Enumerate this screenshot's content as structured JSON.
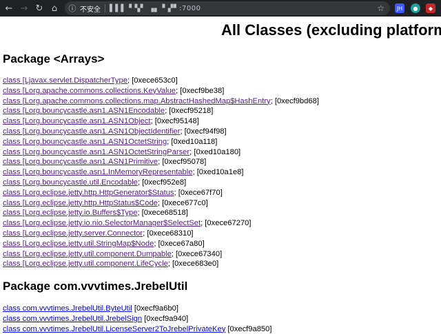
{
  "browser": {
    "security_label": "不安全",
    "url": "▌▌▌ ▘▚▘ ▗▖ ▘▞▘:7000"
  },
  "page": {
    "title": "All Classes (excluding platform"
  },
  "packages": [
    {
      "heading": "Package <Arrays>",
      "classes": [
        {
          "link": "class [Ljavax.servlet.DispatcherType",
          "addr": "; [0xece653c0]"
        },
        {
          "link": "class [Lorg.apache.commons.collections.KeyValue",
          "addr": "; [0xecf9be38]"
        },
        {
          "link": "class [Lorg.apache.commons.collections.map.AbstractHashedMap$HashEntry",
          "addr": "; [0xecf9bd68]"
        },
        {
          "link": "class [Lorg.bouncycastle.asn1.ASN1Encodable",
          "addr": "; [0xecf95218]"
        },
        {
          "link": "class [Lorg.bouncycastle.asn1.ASN1Object",
          "addr": "; [0xecf95148]"
        },
        {
          "link": "class [Lorg.bouncycastle.asn1.ASN1ObjectIdentifier",
          "addr": "; [0xecf94f98]"
        },
        {
          "link": "class [Lorg.bouncycastle.asn1.ASN1OctetString",
          "addr": "; [0xed10a118]"
        },
        {
          "link": "class [Lorg.bouncycastle.asn1.ASN1OctetStringParser",
          "addr": "; [0xed10a180]"
        },
        {
          "link": "class [Lorg.bouncycastle.asn1.ASN1Primitive",
          "addr": "; [0xecf95078]"
        },
        {
          "link": "class [Lorg.bouncycastle.asn1.InMemoryRepresentable",
          "addr": "; [0xed10a1e8]"
        },
        {
          "link": "class [Lorg.bouncycastle.util.Encodable",
          "addr": "; [0xecf952e8]"
        },
        {
          "link": "class [Lorg.eclipse.jetty.http.HttpGenerator$Status",
          "addr": "; [0xece67f70]"
        },
        {
          "link": "class [Lorg.eclipse.jetty.http.HttpStatus$Code",
          "addr": "; [0xece677c0]"
        },
        {
          "link": "class [Lorg.eclipse.jetty.io.Buffers$Type",
          "addr": "; [0xece68518]"
        },
        {
          "link": "class [Lorg.eclipse.jetty.io.nio.SelectorManager$SelectSet",
          "addr": "; [0xece67270]"
        },
        {
          "link": "class [Lorg.eclipse.jetty.server.Connector",
          "addr": "; [0xece68310]"
        },
        {
          "link": "class [Lorg.eclipse.jetty.util.StringMap$Node",
          "addr": "; [0xece67a80]"
        },
        {
          "link": "class [Lorg.eclipse.jetty.util.component.Dumpable",
          "addr": "; [0xece67340]"
        },
        {
          "link": "class [Lorg.eclipse.jetty.util.component.LifeCycle",
          "addr": "; [0xece683e0]"
        }
      ]
    },
    {
      "heading": "Package com.vvvtimes.JrebelUtil",
      "classes": [
        {
          "link": "class com.vvvtimes.JrebelUtil.ByteUtil",
          "addr": " [0xecf9a6b0]"
        },
        {
          "link": "class com.vvvtimes.JrebelUtil.JrebelSign",
          "addr": " [0xecf9a940]"
        },
        {
          "link": "class com.vvvtimes.JrebelUtil.LicenseServer2ToJrebelPrivateKey",
          "addr": " [0xecf9a850]"
        }
      ]
    }
  ]
}
